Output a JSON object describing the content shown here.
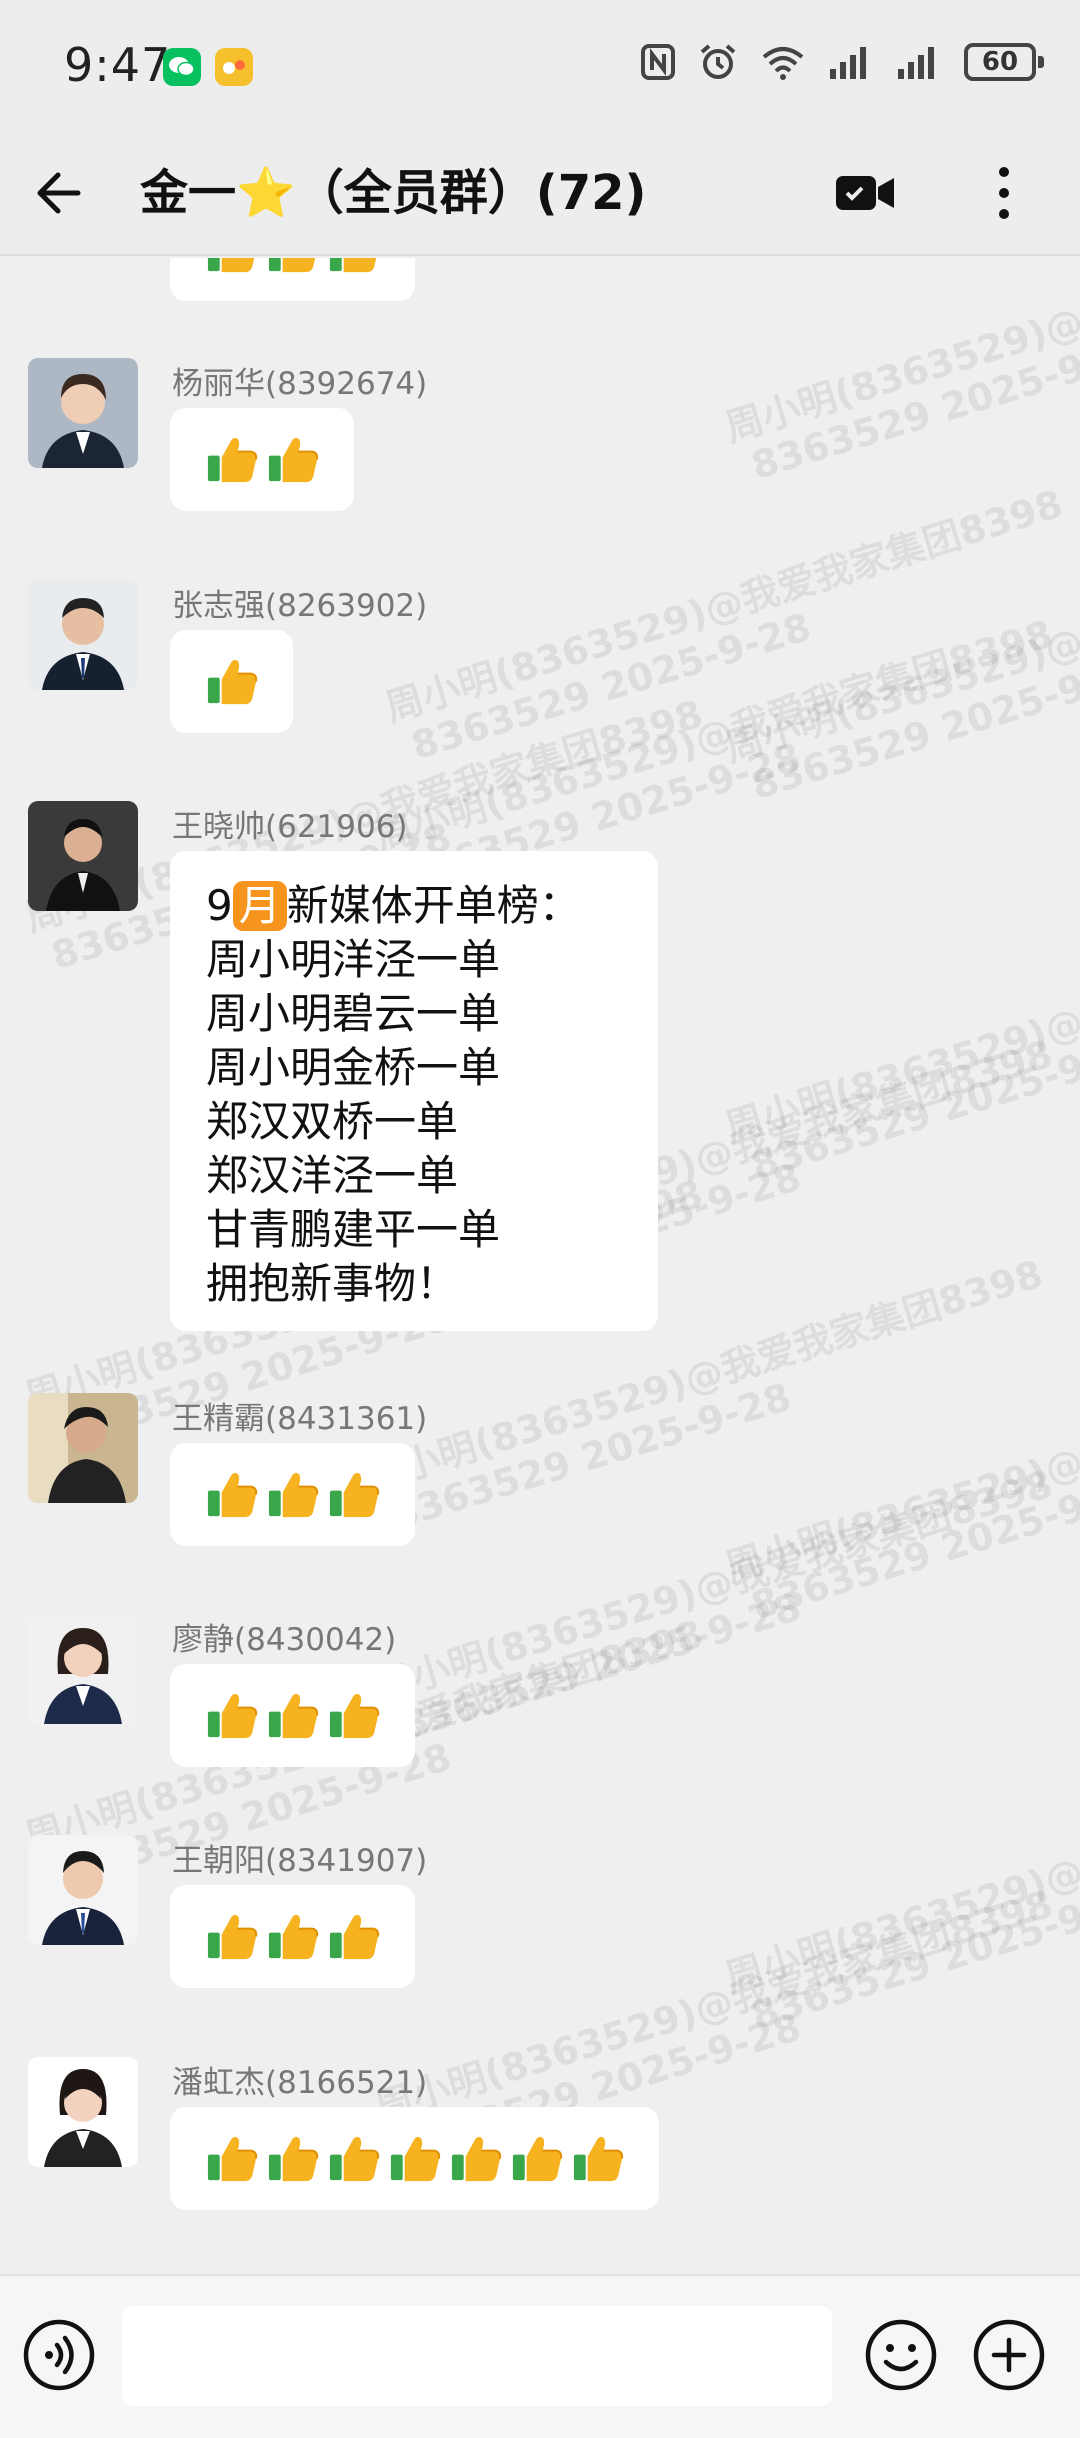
{
  "status_bar": {
    "time": "9:47",
    "battery": "60",
    "icons": [
      "wechat-app-icon",
      "notification-app-icon",
      "nfc-icon",
      "alarm-icon",
      "wifi-icon",
      "signal-icon",
      "signal-icon",
      "battery-icon"
    ]
  },
  "header": {
    "title": "金一⭐（全员群）(72)"
  },
  "watermark": {
    "line1": "周小明(8363529)@我爱我家集团8398",
    "line2": "8363529 2025-9-28"
  },
  "messages": [
    {
      "sender": "",
      "thumbs": 3,
      "partial": true
    },
    {
      "sender": "杨丽华(8392674)",
      "thumbs": 2
    },
    {
      "sender": "张志强(8263902)",
      "thumbs": 1
    },
    {
      "sender": "王晓帅(621906)",
      "text_prefix": "9",
      "month_badge": "月",
      "text_first_rest": "新媒体开单榜：",
      "text_rest": "周小明洋泾一单\n周小明碧云一单\n周小明金桥一单\n郑汉双桥一单\n郑汉洋泾一单\n甘青鹏建平一单\n拥抱新事物！"
    },
    {
      "sender": "王精霸(8431361)",
      "thumbs": 3
    },
    {
      "sender": "廖静(8430042)",
      "thumbs": 3
    },
    {
      "sender": "王朝阳(8341907)",
      "thumbs": 3
    },
    {
      "sender": "潘虹杰(8166521)",
      "thumbs": 7
    }
  ],
  "input": {
    "placeholder": ""
  },
  "colors": {
    "background": "#efefef",
    "bubble": "#ffffff",
    "sender_name": "#777777",
    "month_badge": "#f7941d"
  }
}
